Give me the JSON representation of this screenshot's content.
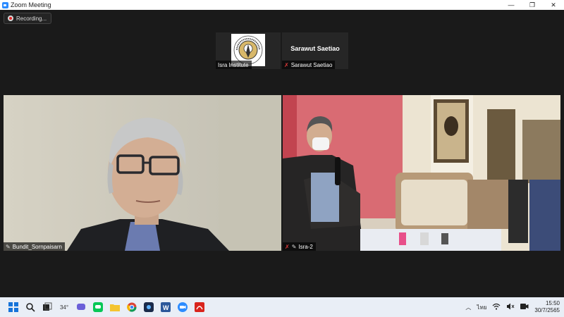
{
  "window": {
    "title": "Zoom Meeting",
    "controls": {
      "minimize": "—",
      "maximize": "❐",
      "close": "✕"
    }
  },
  "recording": {
    "label": "Recording..."
  },
  "thumbnails": [
    {
      "name_tag": "Isra Institute",
      "has_logo": true,
      "logo_text": "สถาบันอิศรา"
    },
    {
      "display_name": "Sarawut Saetiao",
      "name_tag": "Sarawut Saetiao",
      "muted": true
    }
  ],
  "videos": [
    {
      "name_tag": "Bundit_Sornpaisarn"
    },
    {
      "name_tag": "Isra-2"
    }
  ],
  "taskbar": {
    "weather_temp": "34°",
    "tray": {
      "language": "ไทย"
    },
    "time": "15:50",
    "date": "30/7/2565"
  },
  "colors": {
    "accent": "#2d8cff",
    "muted_red": "#e23b3b"
  }
}
